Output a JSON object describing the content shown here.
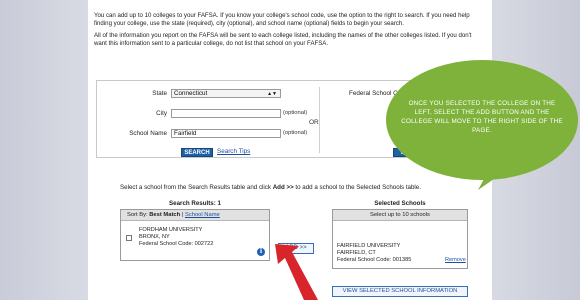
{
  "intro": {
    "para1": "You can add up to 10 colleges to your FAFSA. If you know your college's school code, use the option to the right to search. If you need help finding your college, use the state (required), city (optional), and school name (optional) fields to begin your search.",
    "para2": "All of the information you report on the FAFSA will be sent to each college listed, including the names of the other colleges listed. If you don't want this information sent to a particular college, do not list that school on your FAFSA."
  },
  "search": {
    "state_label": "State",
    "state_value": "Connecticut",
    "city_label": "City",
    "city_value": "",
    "optional": "(optional)",
    "school_name_label": "School Name",
    "school_name_value": "Fairfield",
    "or": "OR",
    "search_button": "SEARCH",
    "search_tips": "Search Tips",
    "fed_code_label": "Federal School C",
    "search_button_2": "SEAR"
  },
  "instructions": {
    "before": "Select a school from the Search Results table and click ",
    "bold": "Add >>",
    "after": " to add a school to the Selected Schools table."
  },
  "results": {
    "title": "Search Results: 1",
    "sort_label": "Sort By:",
    "sort_best": "Best Match",
    "sort_sep": "|",
    "sort_name": "School Name",
    "item": {
      "name": "FORDHAM UNIVERSITY",
      "location": "BRONX, NY",
      "code": "Federal School Code: 002722"
    }
  },
  "add_button": "ADD >>",
  "selected": {
    "title": "Selected Schools",
    "header": "Select up to 10 schools",
    "item": {
      "name": "FAIRFIELD UNIVERSITY",
      "location": "FAIRFIELD, CT",
      "code": "Federal School Code: 001385"
    },
    "remove": "Remove"
  },
  "view_button": "VIEW SELECTED SCHOOL INFORMATION",
  "callout": {
    "text": "ONCE YOU SELECTED THE COLLEGE ON THE LEFT, SELECT THE ADD BUTTON AND THE COLLEGE WILL MOVE TO THE RIGHT SIDE OF THE PAGE.",
    "color": "#7fb23a"
  },
  "colors": {
    "accent_blue": "#1e5fa6",
    "arrow_red": "#d8242b"
  }
}
